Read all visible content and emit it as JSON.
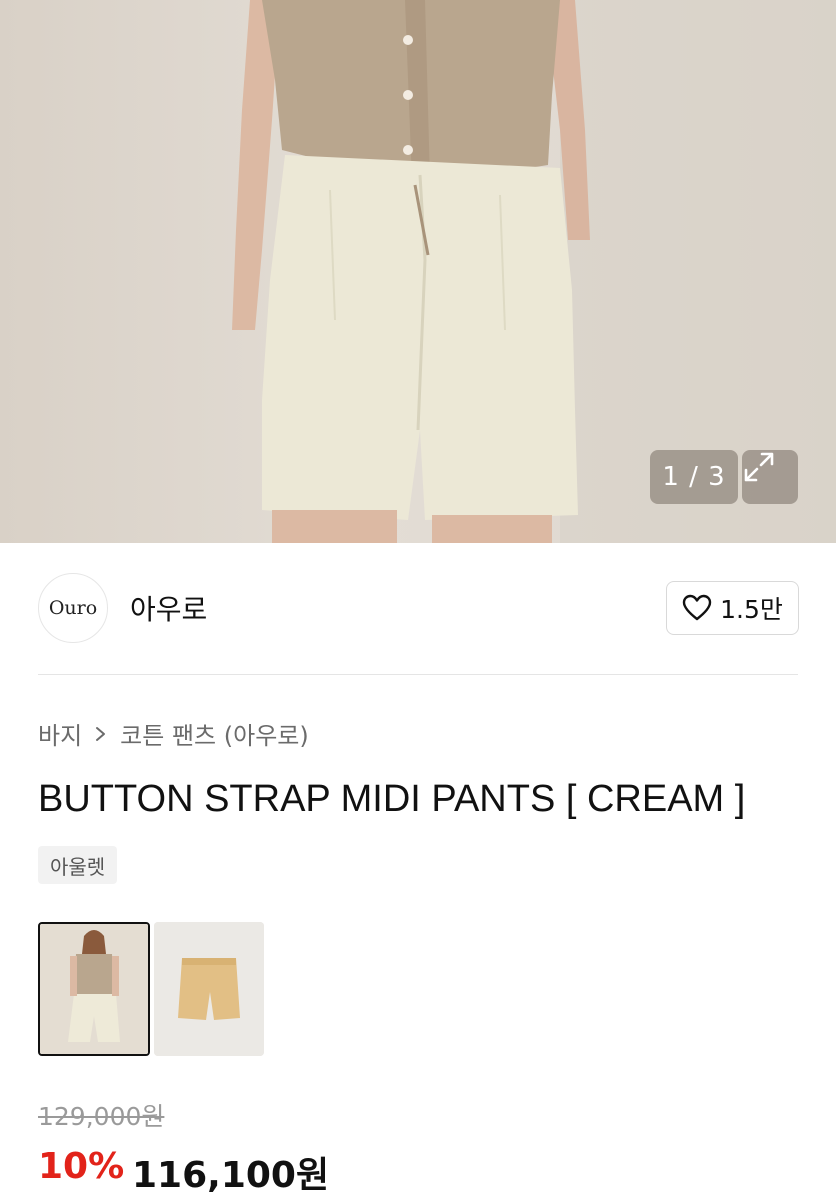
{
  "gallery": {
    "counter": "1 / 3",
    "expand_icon": "expand-icon"
  },
  "store": {
    "logo_text": "Ouro",
    "name": "아우로",
    "like_icon": "heart-icon",
    "like_count": "1.5만"
  },
  "breadcrumb": {
    "category": "바지",
    "separator_icon": "chevron-right-icon",
    "subcategory": "코튼 팬츠 (아우로)"
  },
  "product": {
    "title": "BUTTON STRAP MIDI PANTS [ CREAM ]",
    "tag": "아울렛"
  },
  "thumbnails": [
    {
      "name": "thumbnail-model",
      "selected": true
    },
    {
      "name": "thumbnail-product",
      "selected": false
    }
  ],
  "price": {
    "original": "129,000원",
    "discount": "10%",
    "final": "116,100원",
    "discount_color": "#e2231a"
  }
}
